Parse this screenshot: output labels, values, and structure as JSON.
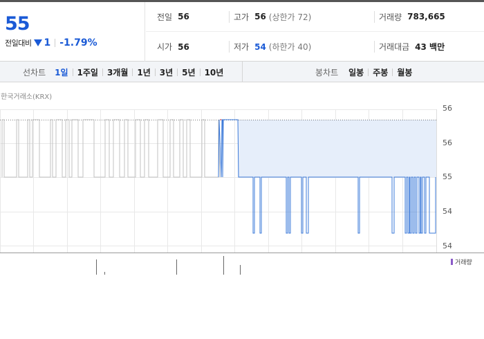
{
  "quote": {
    "price": "55",
    "change_label": "전일대비",
    "change_value": "1",
    "change_rate": "-1.79%",
    "rows": [
      [
        {
          "label": "전일",
          "value": "56",
          "sub": ""
        },
        {
          "label": "고가",
          "value": "56",
          "sub": "(상한가 72)"
        },
        {
          "label": "거래량",
          "value": "783,665",
          "sub": ""
        }
      ],
      [
        {
          "label": "시가",
          "value": "56",
          "sub": ""
        },
        {
          "label": "저가",
          "value": "54",
          "sub": "(하한가 40)"
        },
        {
          "label": "거래대금",
          "value": "43 백만",
          "sub": ""
        }
      ]
    ]
  },
  "tabs": {
    "line_title": "선차트",
    "line_items": [
      "1일",
      "1주일",
      "3개월",
      "1년",
      "3년",
      "5년",
      "10년"
    ],
    "line_active": 0,
    "candle_title": "봉차트",
    "candle_items": [
      "일봉",
      "주봉",
      "월봉"
    ]
  },
  "chart": {
    "exchange": "한국거래소(KRX)",
    "y_ticks": [
      "56",
      "56",
      "55",
      "54",
      "54"
    ],
    "volume_label": "거래량"
  },
  "chart_data": {
    "type": "line",
    "title": "",
    "ylabel": "",
    "xlabel": "",
    "ylim": [
      54,
      56
    ],
    "y_ticks": [
      "56",
      "56",
      "55",
      "54",
      "54"
    ],
    "reference_line": 56,
    "series_note": "intraday price oscillating between 54 and 56",
    "colors": {
      "before_open": "#c0c0c0",
      "up": "#e04040",
      "down": "#3a78d8",
      "fill": "#e6eefa"
    }
  },
  "colors": {
    "accent": "#1a5ad6",
    "grid": "#e5e5e5",
    "volume_bar": "#555555"
  }
}
